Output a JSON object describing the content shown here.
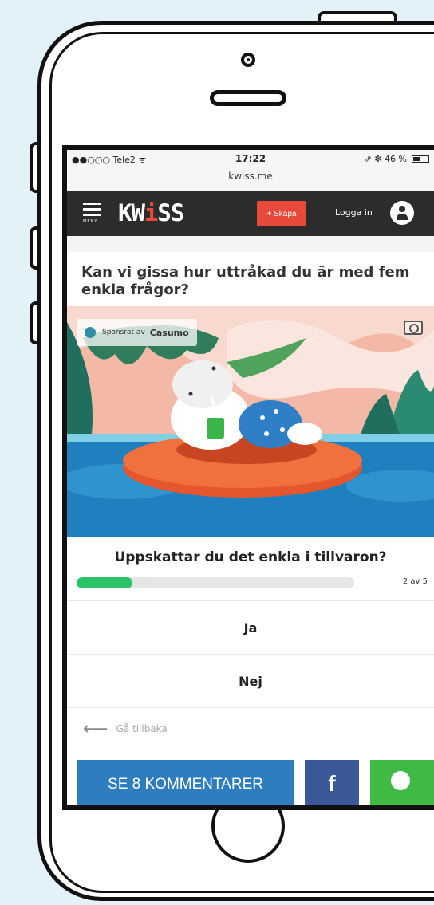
{
  "statusbar": {
    "carrier": "●●○○○ Tele2 ᯤ",
    "time": "17:22",
    "battery": "⇗ ✻ 46 %",
    "url": "kwiss.me"
  },
  "nav": {
    "menu_label": "MENY",
    "logo_left": "KW",
    "logo_i": "i",
    "logo_right": "SS",
    "create_button": "+ Skapa",
    "login": "Logga in"
  },
  "quiz": {
    "title": "Kan vi gissa hur uttråkad du är med fem enkla frågor?",
    "sponsor_prefix": "Sponsrat av",
    "sponsor_name": "Casumo",
    "question": "Uppskattar du det enkla i tillvaron?",
    "progress": 0.2,
    "progress_label": "2 av 5",
    "answers": [
      "Ja",
      "Nej"
    ],
    "back": "Gå tillbaka"
  },
  "share": {
    "comments_button": "SE 8 KOMMENTARER",
    "facebook": "f"
  },
  "colors": {
    "background": "#e3f1f9",
    "navbar": "#2c2c2c",
    "accent_red": "#e74a3b",
    "progress_green": "#2dc36a",
    "comments_blue": "#2e7dbf",
    "facebook_blue": "#3b5998",
    "whatsapp_green": "#3fba45"
  }
}
